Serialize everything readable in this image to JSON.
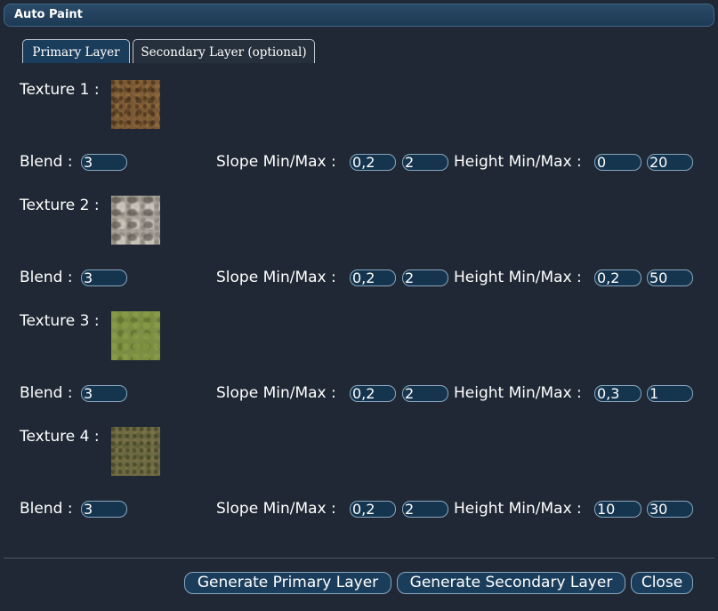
{
  "window": {
    "title": "Auto Paint"
  },
  "tabs": [
    {
      "label": "Primary Layer"
    },
    {
      "label": "Secondary Layer (optional)"
    }
  ],
  "labels": {
    "blend": "Blend :",
    "slope": "Slope Min/Max :",
    "height": "Height Min/Max :"
  },
  "textures": [
    {
      "label": "Texture 1 :",
      "blend": "3",
      "slope_min": "0,2",
      "slope_max": "2",
      "height_min": "0",
      "height_max": "20"
    },
    {
      "label": "Texture 2 :",
      "blend": "3",
      "slope_min": "0,2",
      "slope_max": "2",
      "height_min": "0,2",
      "height_max": "50"
    },
    {
      "label": "Texture 3 :",
      "blend": "3",
      "slope_min": "0,2",
      "slope_max": "2",
      "height_min": "0,3",
      "height_max": "1"
    },
    {
      "label": "Texture 4 :",
      "blend": "3",
      "slope_min": "0,2",
      "slope_max": "2",
      "height_min": "10",
      "height_max": "30"
    }
  ],
  "buttons": {
    "generate_primary": "Generate Primary Layer",
    "generate_secondary": "Generate Secondary Layer",
    "close": "Close"
  }
}
